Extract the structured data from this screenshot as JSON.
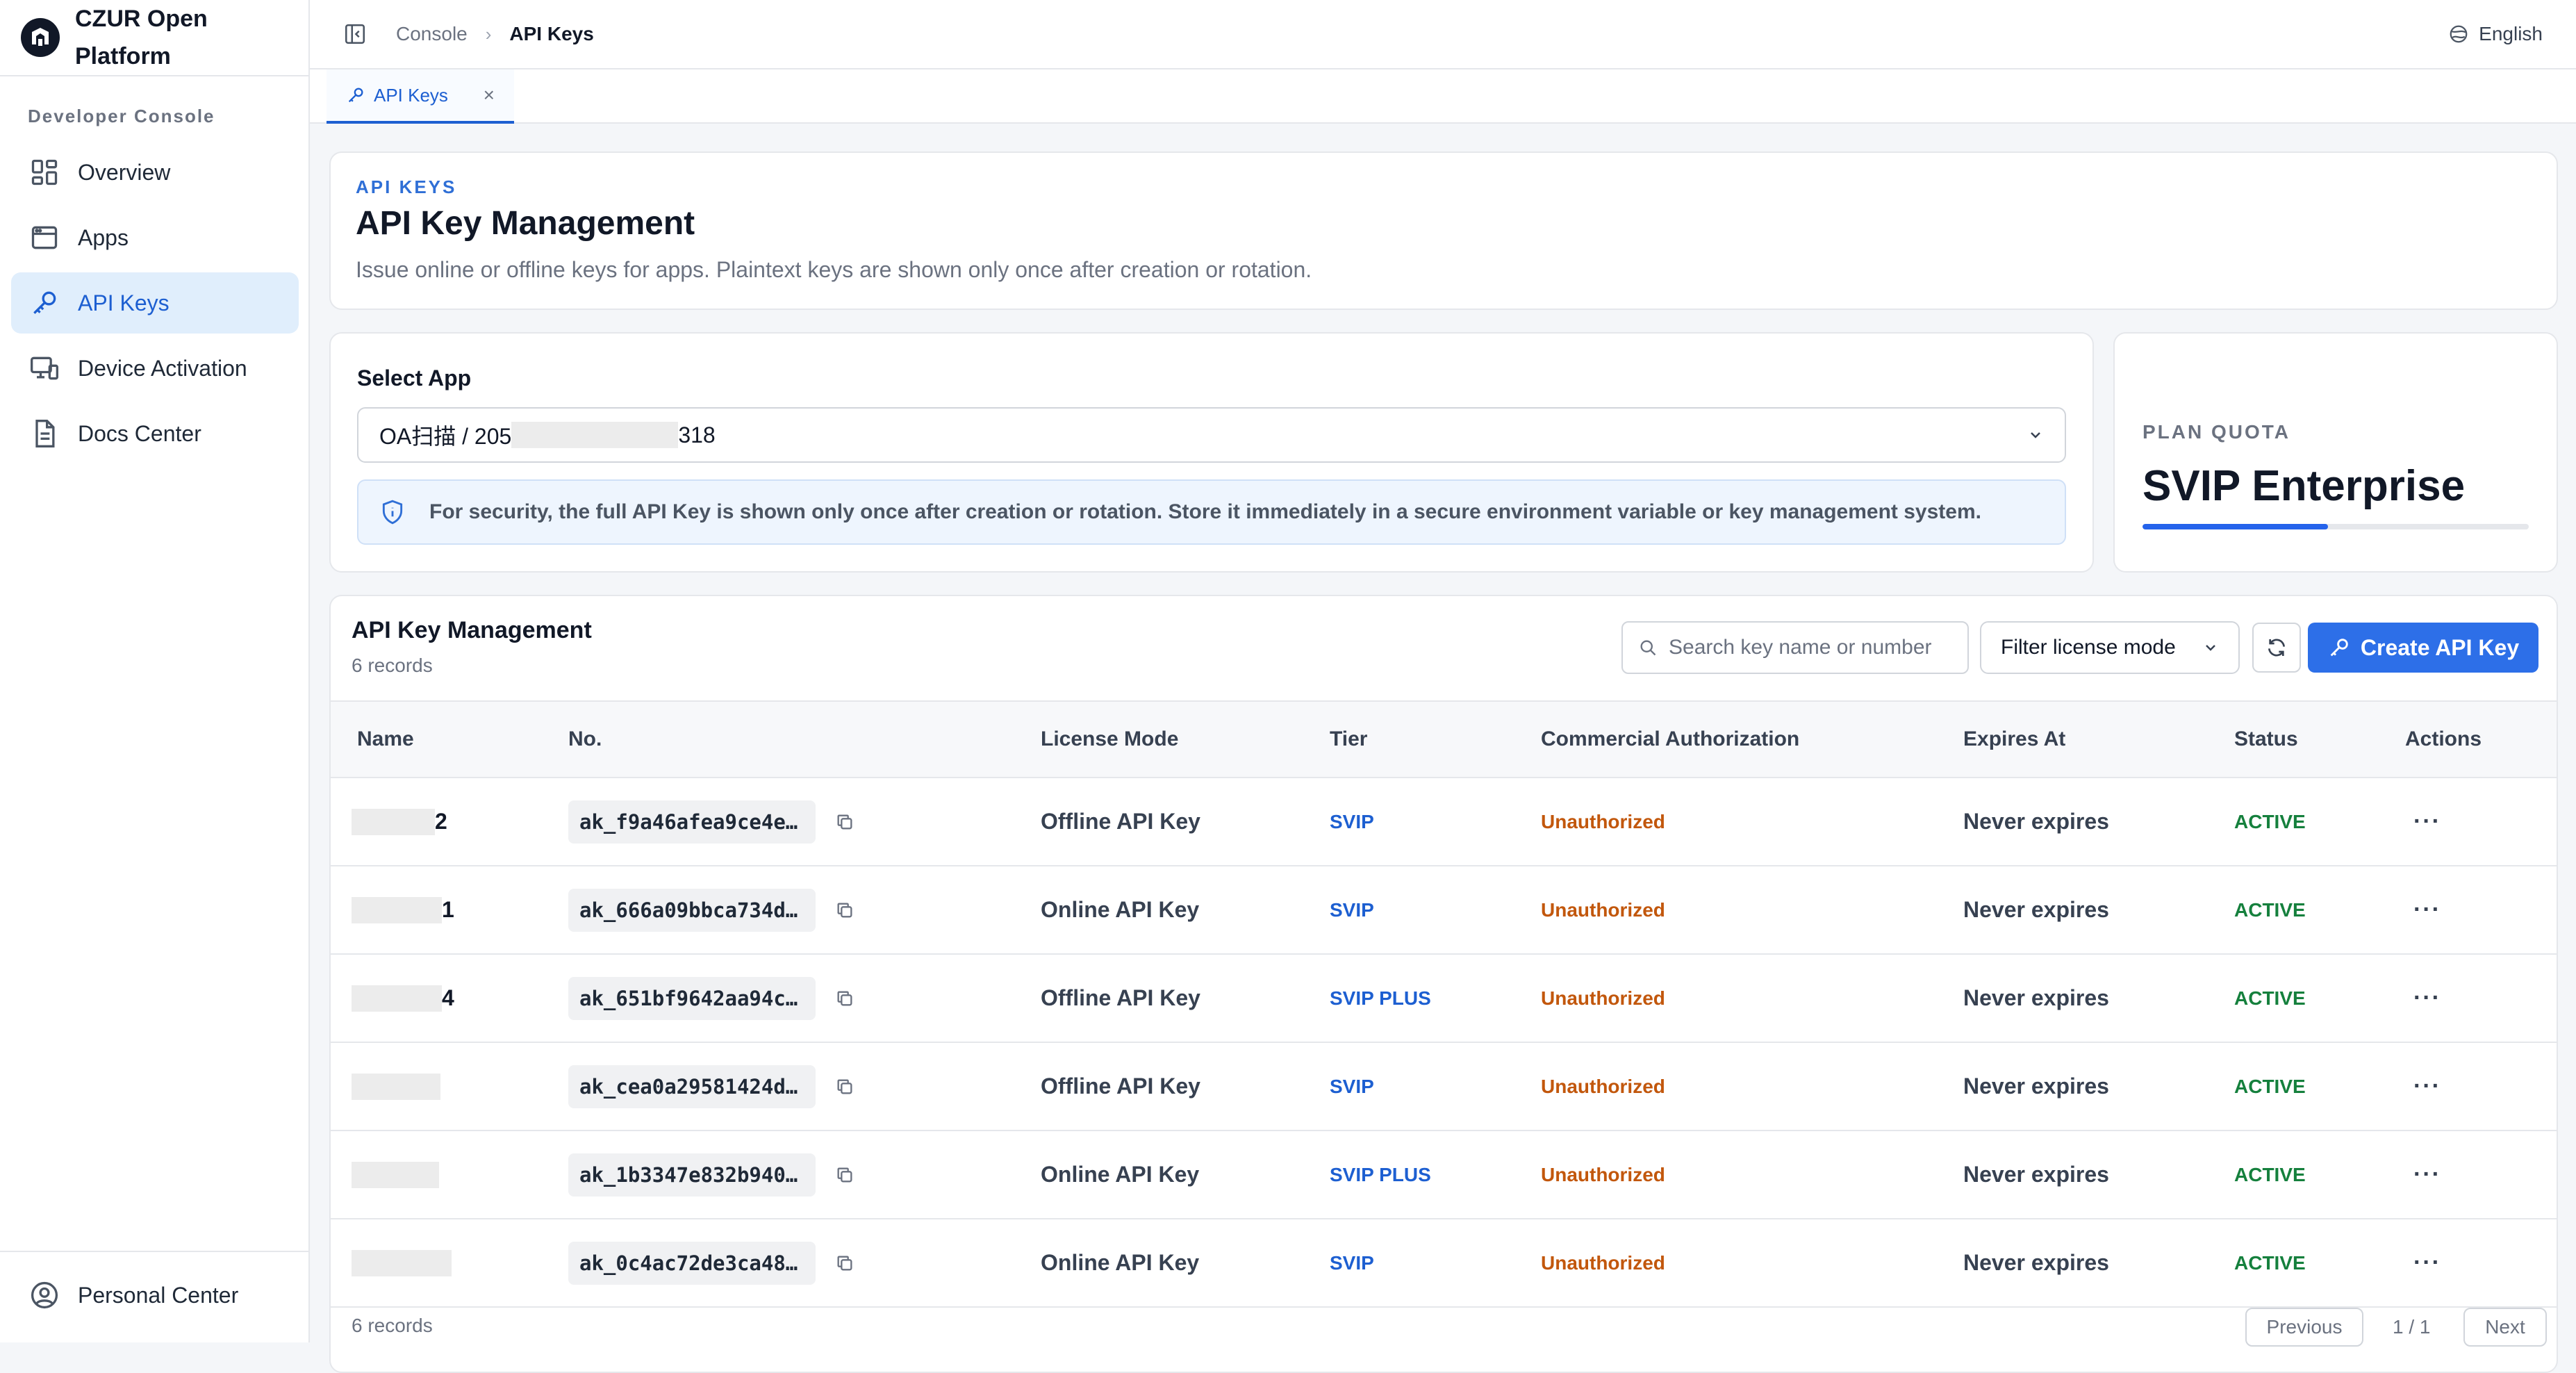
{
  "brand": {
    "name": "CZUR Open Platform"
  },
  "sidebar": {
    "section_label": "Developer Console",
    "items": [
      {
        "label": "Overview",
        "icon": "grid-icon"
      },
      {
        "label": "Apps",
        "icon": "window-icon"
      },
      {
        "label": "API Keys",
        "icon": "key-icon",
        "active": true
      },
      {
        "label": "Device Activation",
        "icon": "devices-icon"
      },
      {
        "label": "Docs Center",
        "icon": "document-icon"
      }
    ],
    "bottom": {
      "label": "Personal Center",
      "icon": "user-circle-icon"
    }
  },
  "header": {
    "breadcrumb": [
      "Console",
      "API Keys"
    ],
    "language": "English"
  },
  "tabs": [
    {
      "label": "API Keys",
      "closable": true
    }
  ],
  "intro": {
    "eyebrow": "API KEYS",
    "title": "API Key Management",
    "subtitle": "Issue online or offline keys for apps. Plaintext keys are shown only once after creation or rotation."
  },
  "select_app": {
    "label": "Select App",
    "value_prefix": "OA扫描 / 205",
    "value_suffix": "318",
    "notice": "For security, the full API Key is shown only once after creation or rotation. Store it immediately in a secure environment variable or key management system."
  },
  "quota": {
    "eyebrow": "PLAN QUOTA",
    "plan": "SVIP Enterprise",
    "progress_fraction": 0.48
  },
  "table": {
    "title": "API Key Management",
    "records": "6 records",
    "search_placeholder": "Search key name or number",
    "filter_label": "Filter license mode",
    "create_label": "Create API Key",
    "columns": [
      "Name",
      "No.",
      "License Mode",
      "Tier",
      "Commercial Authorization",
      "Expires At",
      "Status",
      "Actions"
    ],
    "rows": [
      {
        "name_suffix": "2",
        "no": "ak_f9a46afea9ce4e…",
        "mode": "Offline API Key",
        "tier": "SVIP",
        "auth": "Unauthorized",
        "expires": "Never expires",
        "status": "ACTIVE"
      },
      {
        "name_suffix": "1",
        "no": "ak_666a09bbca734d…",
        "mode": "Online API Key",
        "tier": "SVIP",
        "auth": "Unauthorized",
        "expires": "Never expires",
        "status": "ACTIVE"
      },
      {
        "name_suffix": "4",
        "no": "ak_651bf9642aa94c…",
        "mode": "Offline API Key",
        "tier": "SVIP PLUS",
        "auth": "Unauthorized",
        "expires": "Never expires",
        "status": "ACTIVE"
      },
      {
        "name_suffix": "",
        "no": "ak_cea0a29581424d…",
        "mode": "Offline API Key",
        "tier": "SVIP",
        "auth": "Unauthorized",
        "expires": "Never expires",
        "status": "ACTIVE"
      },
      {
        "name_suffix": "",
        "no": "ak_1b3347e832b940…",
        "mode": "Online API Key",
        "tier": "SVIP PLUS",
        "auth": "Unauthorized",
        "expires": "Never expires",
        "status": "ACTIVE"
      },
      {
        "name_suffix": "",
        "no": "ak_0c4ac72de3ca48…",
        "mode": "Online API Key",
        "tier": "SVIP",
        "auth": "Unauthorized",
        "expires": "Never expires",
        "status": "ACTIVE"
      }
    ],
    "more_label": "···",
    "footer": {
      "records": "6 records",
      "previous": "Previous",
      "page": "1 / 1",
      "next": "Next"
    }
  },
  "colors": {
    "accent": "#2d6fe8",
    "active_nav_bg": "#e0eefc",
    "status_active": "#15803d",
    "unauthorized": "#c2570c",
    "tier": "#1d5fd1"
  }
}
